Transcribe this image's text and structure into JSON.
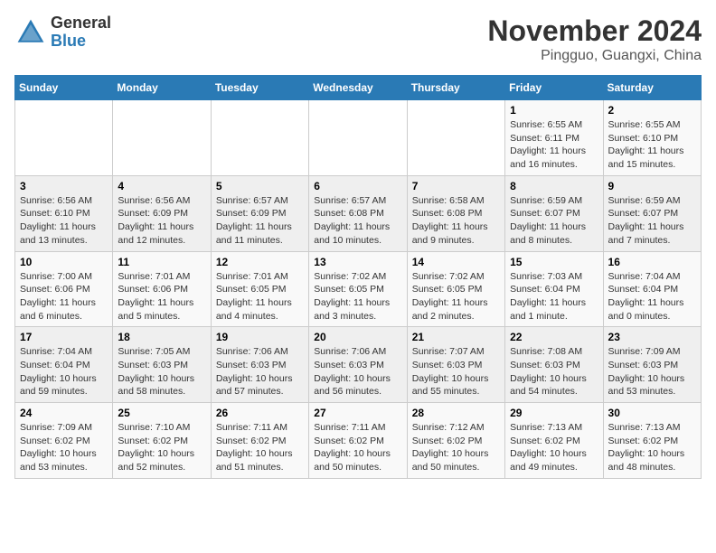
{
  "header": {
    "logo_line1": "General",
    "logo_line2": "Blue",
    "title": "November 2024",
    "subtitle": "Pingguo, Guangxi, China"
  },
  "weekdays": [
    "Sunday",
    "Monday",
    "Tuesday",
    "Wednesday",
    "Thursday",
    "Friday",
    "Saturday"
  ],
  "weeks": [
    [
      {
        "day": "",
        "info": ""
      },
      {
        "day": "",
        "info": ""
      },
      {
        "day": "",
        "info": ""
      },
      {
        "day": "",
        "info": ""
      },
      {
        "day": "",
        "info": ""
      },
      {
        "day": "1",
        "info": "Sunrise: 6:55 AM\nSunset: 6:11 PM\nDaylight: 11 hours and 16 minutes."
      },
      {
        "day": "2",
        "info": "Sunrise: 6:55 AM\nSunset: 6:10 PM\nDaylight: 11 hours and 15 minutes."
      }
    ],
    [
      {
        "day": "3",
        "info": "Sunrise: 6:56 AM\nSunset: 6:10 PM\nDaylight: 11 hours and 13 minutes."
      },
      {
        "day": "4",
        "info": "Sunrise: 6:56 AM\nSunset: 6:09 PM\nDaylight: 11 hours and 12 minutes."
      },
      {
        "day": "5",
        "info": "Sunrise: 6:57 AM\nSunset: 6:09 PM\nDaylight: 11 hours and 11 minutes."
      },
      {
        "day": "6",
        "info": "Sunrise: 6:57 AM\nSunset: 6:08 PM\nDaylight: 11 hours and 10 minutes."
      },
      {
        "day": "7",
        "info": "Sunrise: 6:58 AM\nSunset: 6:08 PM\nDaylight: 11 hours and 9 minutes."
      },
      {
        "day": "8",
        "info": "Sunrise: 6:59 AM\nSunset: 6:07 PM\nDaylight: 11 hours and 8 minutes."
      },
      {
        "day": "9",
        "info": "Sunrise: 6:59 AM\nSunset: 6:07 PM\nDaylight: 11 hours and 7 minutes."
      }
    ],
    [
      {
        "day": "10",
        "info": "Sunrise: 7:00 AM\nSunset: 6:06 PM\nDaylight: 11 hours and 6 minutes."
      },
      {
        "day": "11",
        "info": "Sunrise: 7:01 AM\nSunset: 6:06 PM\nDaylight: 11 hours and 5 minutes."
      },
      {
        "day": "12",
        "info": "Sunrise: 7:01 AM\nSunset: 6:05 PM\nDaylight: 11 hours and 4 minutes."
      },
      {
        "day": "13",
        "info": "Sunrise: 7:02 AM\nSunset: 6:05 PM\nDaylight: 11 hours and 3 minutes."
      },
      {
        "day": "14",
        "info": "Sunrise: 7:02 AM\nSunset: 6:05 PM\nDaylight: 11 hours and 2 minutes."
      },
      {
        "day": "15",
        "info": "Sunrise: 7:03 AM\nSunset: 6:04 PM\nDaylight: 11 hours and 1 minute."
      },
      {
        "day": "16",
        "info": "Sunrise: 7:04 AM\nSunset: 6:04 PM\nDaylight: 11 hours and 0 minutes."
      }
    ],
    [
      {
        "day": "17",
        "info": "Sunrise: 7:04 AM\nSunset: 6:04 PM\nDaylight: 10 hours and 59 minutes."
      },
      {
        "day": "18",
        "info": "Sunrise: 7:05 AM\nSunset: 6:03 PM\nDaylight: 10 hours and 58 minutes."
      },
      {
        "day": "19",
        "info": "Sunrise: 7:06 AM\nSunset: 6:03 PM\nDaylight: 10 hours and 57 minutes."
      },
      {
        "day": "20",
        "info": "Sunrise: 7:06 AM\nSunset: 6:03 PM\nDaylight: 10 hours and 56 minutes."
      },
      {
        "day": "21",
        "info": "Sunrise: 7:07 AM\nSunset: 6:03 PM\nDaylight: 10 hours and 55 minutes."
      },
      {
        "day": "22",
        "info": "Sunrise: 7:08 AM\nSunset: 6:03 PM\nDaylight: 10 hours and 54 minutes."
      },
      {
        "day": "23",
        "info": "Sunrise: 7:09 AM\nSunset: 6:03 PM\nDaylight: 10 hours and 53 minutes."
      }
    ],
    [
      {
        "day": "24",
        "info": "Sunrise: 7:09 AM\nSunset: 6:02 PM\nDaylight: 10 hours and 53 minutes."
      },
      {
        "day": "25",
        "info": "Sunrise: 7:10 AM\nSunset: 6:02 PM\nDaylight: 10 hours and 52 minutes."
      },
      {
        "day": "26",
        "info": "Sunrise: 7:11 AM\nSunset: 6:02 PM\nDaylight: 10 hours and 51 minutes."
      },
      {
        "day": "27",
        "info": "Sunrise: 7:11 AM\nSunset: 6:02 PM\nDaylight: 10 hours and 50 minutes."
      },
      {
        "day": "28",
        "info": "Sunrise: 7:12 AM\nSunset: 6:02 PM\nDaylight: 10 hours and 50 minutes."
      },
      {
        "day": "29",
        "info": "Sunrise: 7:13 AM\nSunset: 6:02 PM\nDaylight: 10 hours and 49 minutes."
      },
      {
        "day": "30",
        "info": "Sunrise: 7:13 AM\nSunset: 6:02 PM\nDaylight: 10 hours and 48 minutes."
      }
    ]
  ]
}
